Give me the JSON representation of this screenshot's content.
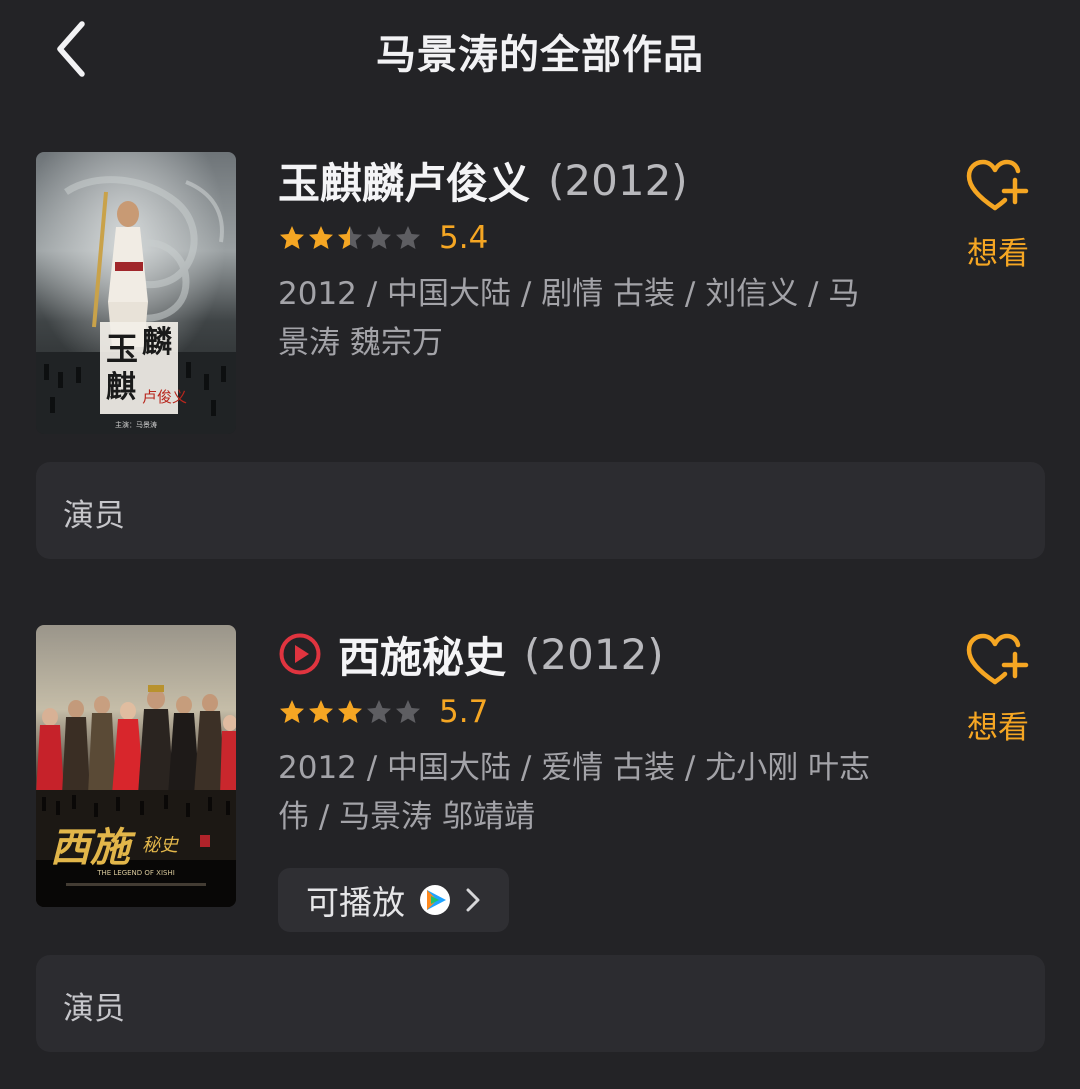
{
  "header": {
    "title": "马景涛的全部作品"
  },
  "works": [
    {
      "title": "玉麒麟卢俊义",
      "year": "(2012)",
      "score": "5.4",
      "rating": 2.5,
      "meta": "2012 / 中国大陆 / 剧情 古装 / 刘信义 / 马景涛 魏宗万",
      "want_label": "想看",
      "role": "演员",
      "playable": false,
      "poster": {
        "title_chars": [
          "玉",
          "麒",
          "麟"
        ],
        "small_title": "卢俊义",
        "credit": "主演：马景涛"
      }
    },
    {
      "title": "西施秘史",
      "year": "(2012)",
      "score": "5.7",
      "rating": 3,
      "meta": "2012 / 中国大陆 / 爱情 古装 / 尤小刚 叶志伟 / 马景涛 邬靖靖",
      "want_label": "想看",
      "role": "演员",
      "playable": true,
      "play_label": "可播放",
      "poster": {
        "title_text": "西施",
        "small_title": "秘史",
        "subtitle": "THE LEGEND OF XISHI"
      }
    }
  ],
  "colors": {
    "background": "#232326",
    "accent": "#f5a623",
    "play_red": "#e0343f",
    "panel": "#2c2c30"
  },
  "icons": {
    "back": "chevron-left-icon",
    "want": "heart-plus-icon",
    "play": "play-circle-icon",
    "platform": "tencent-video-icon",
    "chip_arrow": "chevron-right-icon"
  }
}
